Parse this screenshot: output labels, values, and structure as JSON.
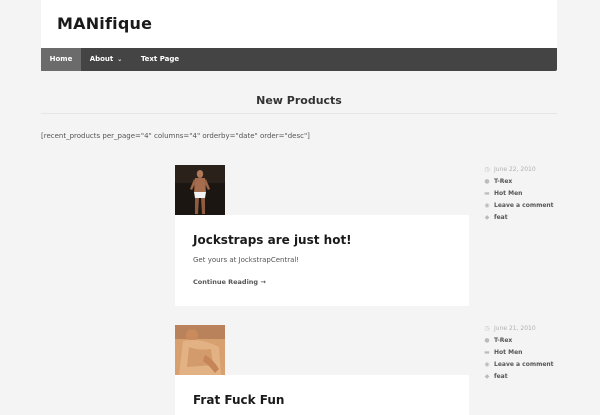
{
  "site": {
    "title": "MANifique"
  },
  "nav": {
    "items": [
      {
        "label": "Home",
        "active": true
      },
      {
        "label": "About",
        "has_dropdown": true
      },
      {
        "label": "Text Page"
      }
    ]
  },
  "page": {
    "heading": "New Products",
    "shortcode": "[recent_products per_page=\"4\" columns=\"4\" orderby=\"date\" order=\"desc\"]"
  },
  "posts": [
    {
      "title": "Jockstraps are just hot!",
      "excerpt": "Get yours at JockstrapCentral!",
      "continue_label": "Continue Reading →",
      "date": "June 22, 2010",
      "author": "T-Rex",
      "category": "Hot Men",
      "comments": "Leave a comment",
      "tag": "feat"
    },
    {
      "title": "Frat Fuck Fun",
      "date": "June 21, 2010",
      "author": "T-Rex",
      "category": "Hot Men",
      "comments": "Leave a comment",
      "tag": "feat"
    }
  ],
  "icons": {
    "date": "clock-icon",
    "author": "user-icon",
    "category": "folder-icon",
    "comments": "comment-icon",
    "tag": "tag-icon"
  },
  "colors": {
    "background": "#f4f4f4",
    "navbar": "#444444",
    "nav_active": "#6b6b6b",
    "card": "#ffffff"
  }
}
